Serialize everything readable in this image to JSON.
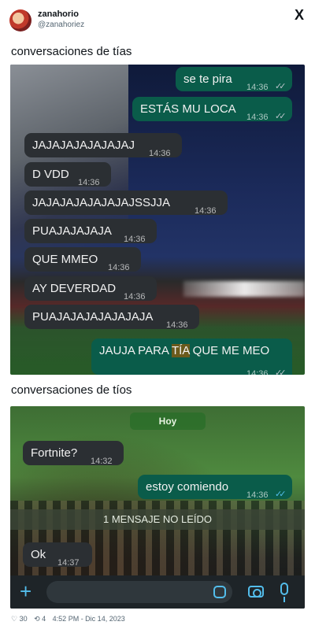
{
  "author": {
    "name": "zanahorio",
    "handle": "@zanahoriez"
  },
  "logo": "X",
  "captions": {
    "top": "conversaciones de tías",
    "bottom": "conversaciones de tíos"
  },
  "chat_top": {
    "messages": [
      {
        "dir": "out",
        "text": "se te pira",
        "time": "14:36",
        "ticks": "✓✓"
      },
      {
        "dir": "out",
        "text": "ESTÁS MU LOCA",
        "time": "14:36",
        "ticks": "✓✓"
      },
      {
        "dir": "in",
        "text": "JAJAJAJAJAJAJAJ",
        "time": "14:36"
      },
      {
        "dir": "in",
        "text": "D VDD",
        "time": "14:36"
      },
      {
        "dir": "in",
        "text": "JAJAJAJAJAJAJAJSSJJA",
        "time": "14:36"
      },
      {
        "dir": "in",
        "text": "PUAJAJAJAJA",
        "time": "14:36"
      },
      {
        "dir": "in",
        "text": "QUE MMEO",
        "time": "14:36"
      },
      {
        "dir": "in",
        "text": "AY DEVERDAD",
        "time": "14:36"
      },
      {
        "dir": "in",
        "text": "PUAJAJAJAJAJAJAJA",
        "time": "14:36"
      },
      {
        "dir": "out",
        "text_before": "JAUJA PARA ",
        "text_highlight": "TÍA",
        "text_after": " QUE ME MEO",
        "time": "14:36",
        "ticks": "✓✓"
      }
    ]
  },
  "chat_bottom": {
    "day_label": "Hoy",
    "messages": [
      {
        "dir": "in",
        "text": "Fortnite?",
        "time": "14:32"
      },
      {
        "dir": "out",
        "text": "estoy comiendo",
        "time": "14:36",
        "ticks": "✓✓"
      },
      {
        "dir": "in",
        "text": "Ok",
        "time": "14:37"
      }
    ],
    "unread_banner": "1 MENSAJE NO LEÍDO"
  },
  "composer": {
    "plus_label": "+",
    "icons": [
      "plus-icon",
      "sticker-icon",
      "camera-icon",
      "mic-icon"
    ]
  },
  "footer": {
    "likes": "♡ 30",
    "retweets": "⟲ 4",
    "timestamp": "4:52 PM - Dic 14, 2023"
  },
  "colors": {
    "outgoing": "#0a5c4a",
    "incoming": "#2b2f33",
    "accent": "#53bdeb"
  }
}
